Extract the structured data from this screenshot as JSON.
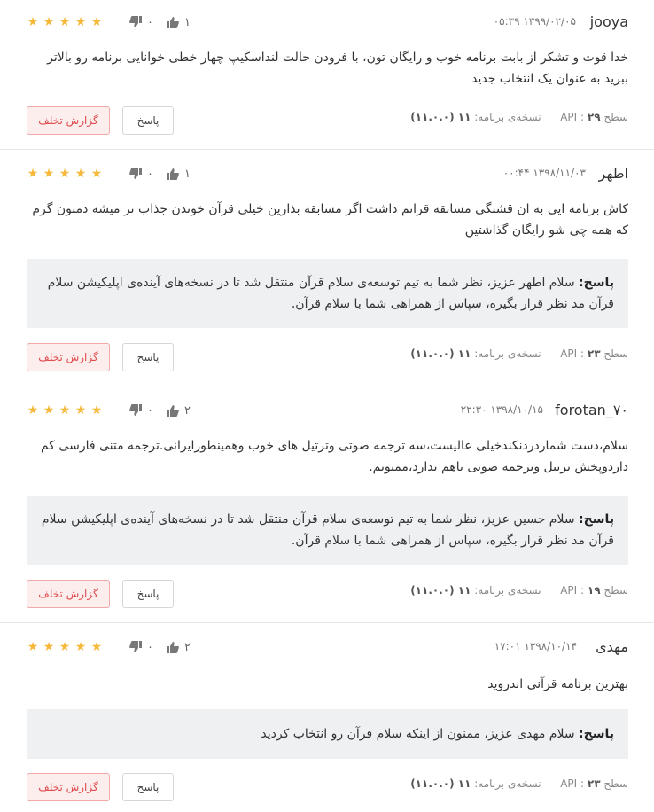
{
  "reviews": [
    {
      "username": "jooya",
      "date": "۰۵:۳۹ ۱۳۹۹/۰۲/۰۵",
      "stars": 5,
      "likes": "۱",
      "dislikes": "۰",
      "text": "خدا قوت و تشکر از بابت برنامه خوب و رایگان تون، با فزودن حالت لنداسکیپ چهار خطی خوانایی برنامه رو بالاتر ببرید به عنوان یک انتخاب جدید",
      "reply_label": "",
      "reply_text": "",
      "api_label": "سطح API :",
      "api_value": "۲۹",
      "version_label": "نسخه‌ی برنامه:",
      "version_value": "۱۱ (۱۱.۰.۰)",
      "reply_button": "پاسخ",
      "report_button": "گزارش تخلف"
    },
    {
      "username": "اطهر",
      "date": "۰۰:۴۴ ۱۳۹۸/۱۱/۰۳",
      "stars": 5,
      "likes": "۱",
      "dislikes": "۰",
      "text": "کاش برنامه ایی به ان قشنگی مسابقه قرانم داشت اگر مسابقه بذارین خیلی قرآن خوندن جذاب تر میشه دمتون گرم که همه چی شو رایگان گذاشتین",
      "reply_label": "پاسخ:",
      "reply_text": "سلام اطهر عزیز، نظر شما به تیم توسعه‌ی سلام قرآن منتقل شد تا در نسخه‌های آینده‌ی اپلیکیشن سلام قرآن مد نظر قرار بگیره، سپاس از همراهی شما با سلام قرآن.",
      "api_label": "سطح API :",
      "api_value": "۲۳",
      "version_label": "نسخه‌ی برنامه:",
      "version_value": "۱۱ (۱۱.۰.۰)",
      "reply_button": "پاسخ",
      "report_button": "گزارش تخلف"
    },
    {
      "username": "forotan_۷۰",
      "date": "۲۲:۳۰ ۱۳۹۸/۱۰/۱۵",
      "stars": 5,
      "likes": "۲",
      "dislikes": "۰",
      "text": "سلام،دست شماردردنکندخیلی عالیست،سه ترجمه صوتی وترتیل های خوب وهمینطورایرانی.ترجمه متنی فارسی کم داردوپخش ترتیل وترجمه صوتی باهم ندارد،ممنونم.",
      "reply_label": "پاسخ:",
      "reply_text": "سلام حسین عزیز، نظر شما به تیم توسعه‌ی سلام قرآن منتقل شد تا در نسخه‌های آینده‌ی اپلیکیشن سلام قرآن مد نظر قرار بگیره، سپاس از همراهی شما با سلام قرآن.",
      "api_label": "سطح API :",
      "api_value": "۱۹",
      "version_label": "نسخه‌ی برنامه:",
      "version_value": "۱۱ (۱۱.۰.۰)",
      "reply_button": "پاسخ",
      "report_button": "گزارش تخلف"
    },
    {
      "username": "مهدی",
      "date": "۱۷:۰۱ ۱۳۹۸/۱۰/۱۴",
      "stars": 5,
      "likes": "۲",
      "dislikes": "۰",
      "text": "بهترین برنامه قرآنی اندروید",
      "reply_label": "پاسخ:",
      "reply_text": "سلام مهدی عزیز، ممنون از اینکه سلام قرآن رو انتخاب کردید",
      "api_label": "سطح API :",
      "api_value": "۲۳",
      "version_label": "نسخه‌ی برنامه:",
      "version_value": "۱۱ (۱۱.۰.۰)",
      "reply_button": "پاسخ",
      "report_button": "گزارش تخلف"
    }
  ],
  "colors": {
    "star": "#f6b93b",
    "report": "#e0494b",
    "reply_bg": "#eef0f2"
  },
  "icons": {
    "like": "thumbs-up-icon",
    "dislike": "thumbs-down-icon",
    "star": "star-icon"
  }
}
